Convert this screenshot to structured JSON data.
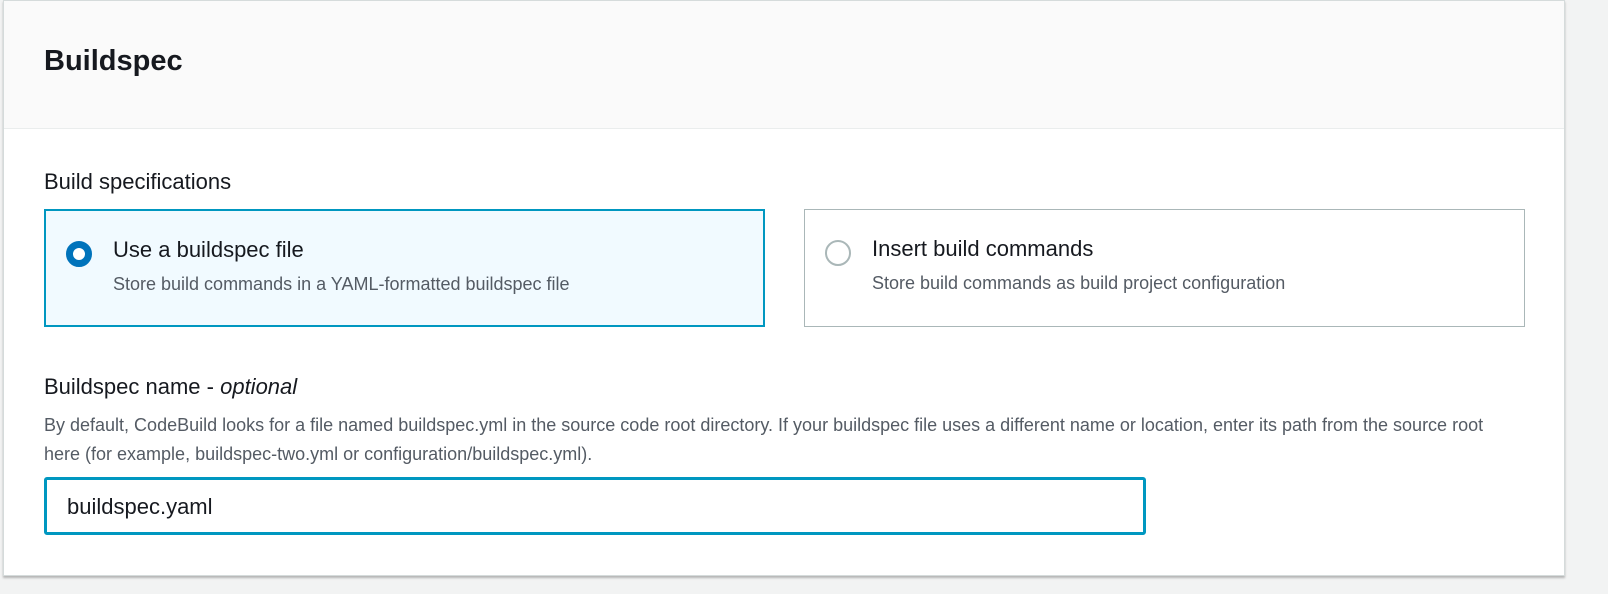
{
  "panel": {
    "title": "Buildspec"
  },
  "build_specifications": {
    "label": "Build specifications",
    "options": [
      {
        "title": "Use a buildspec file",
        "description": "Store build commands in a YAML-formatted buildspec file",
        "selected": true
      },
      {
        "title": "Insert build commands",
        "description": "Store build commands as build project configuration",
        "selected": false
      }
    ]
  },
  "buildspec_name": {
    "label": "Buildspec name - ",
    "label_optional": "optional",
    "description": "By default, CodeBuild looks for a file named buildspec.yml in the source code root directory. If your buildspec file uses a different name or location, enter its path from the source root here (for example, buildspec-two.yml or configuration/buildspec.yml).",
    "value": "buildspec.yaml"
  },
  "colors": {
    "accent": "#0073bb",
    "focus": "#0097c0"
  }
}
